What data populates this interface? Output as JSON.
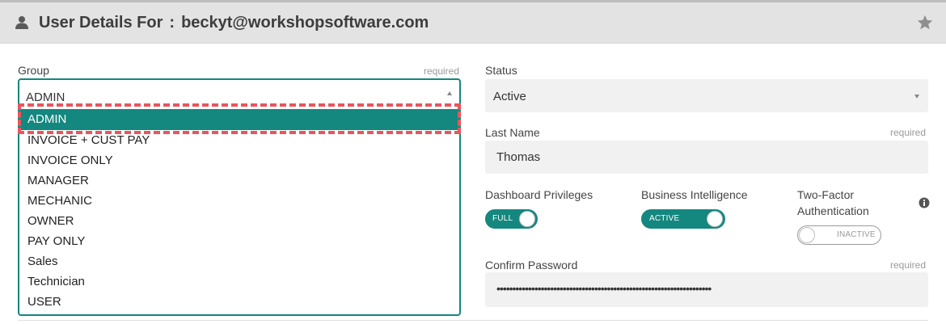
{
  "header": {
    "title_prefix": "User Details For",
    "separator": ":",
    "email": "beckyt@workshopsoftware.com",
    "icons": {
      "user": "user-icon",
      "star": "star-icon"
    }
  },
  "group": {
    "label": "Group",
    "required": "required",
    "value": "ADMIN",
    "options": [
      "ADMIN",
      "INVOICE + CUST PAY",
      "INVOICE ONLY",
      "MANAGER",
      "MECHANIC",
      "OWNER",
      "PAY ONLY",
      "Sales",
      "Technician",
      "USER"
    ],
    "selected_index": 0
  },
  "status": {
    "label": "Status",
    "value": "Active"
  },
  "last_name": {
    "label": "Last Name",
    "required": "required",
    "value": "Thomas"
  },
  "dashboard_privileges": {
    "label": "Dashboard Privileges",
    "toggle_label": "FULL",
    "on": true
  },
  "business_intelligence": {
    "label": "Business Intelligence",
    "toggle_label": "ACTIVE",
    "on": true
  },
  "two_factor": {
    "label_line1": "Two-Factor",
    "label_line2": "Authentication",
    "toggle_label": "INACTIVE",
    "on": false,
    "icon": "info-icon"
  },
  "confirm_password": {
    "label": "Confirm Password",
    "required": "required",
    "value": "••••••••••••••••••••••••••••••••••••••••••••••••••••••••••••••••••••"
  },
  "colors": {
    "accent": "#14877f",
    "highlight": "#e8555d",
    "header_bg": "#e3e3e3",
    "field_bg": "#f1f1f1"
  }
}
